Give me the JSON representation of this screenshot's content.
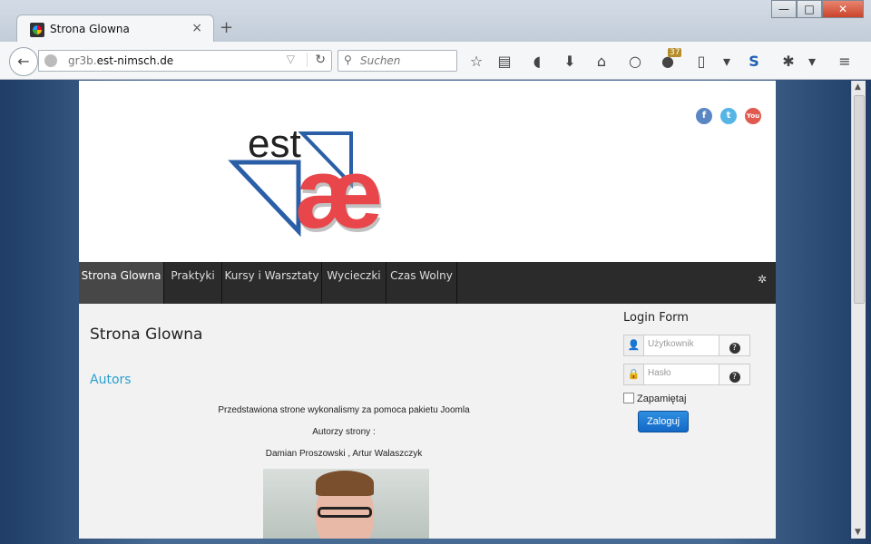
{
  "browser": {
    "tab_title": "Strona Glowna",
    "tab_close": "×",
    "new_tab": "+",
    "url_prefix": "gr3b.",
    "url_domain": "est-nimsch.de",
    "search_placeholder": "Suchen",
    "badge_count": "37",
    "window_controls": {
      "minimize": "—",
      "maximize": "□",
      "close": "✕"
    }
  },
  "site": {
    "logo_text_top": "est",
    "logo_text_main": "æ",
    "social": [
      {
        "name": "facebook",
        "label": "f",
        "color": "#5b86c4"
      },
      {
        "name": "twitter",
        "label": "t",
        "color": "#57b5e6"
      },
      {
        "name": "youtube",
        "label": "You",
        "color": "#e05a4f"
      }
    ],
    "nav": [
      "Strona Glowna",
      "Praktyki",
      "Kursy i Warsztaty",
      "Wycieczki",
      "Czas Wolny"
    ],
    "content": {
      "heading": "Strona Glowna",
      "subheading": "Autors",
      "p1": "Przedstawiona strone wykonalismy za pomoca pakietu Joomla",
      "p2": "Autorzy strony :",
      "p3": "Damian Proszowski , Artur Walaszczyk"
    },
    "login": {
      "title": "Login Form",
      "username_placeholder": "Użytkownik",
      "password_placeholder": "Hasło",
      "remember_label": "Zapamiętaj",
      "submit_label": "Zaloguj"
    }
  },
  "colors": {
    "nav_bg": "#2b2b2b",
    "nav_active": "#474747",
    "link_blue": "#2a9fd0",
    "button_blue": "#1369c7",
    "logo_red": "#e8464a",
    "logo_blue": "#2a5fa7"
  }
}
